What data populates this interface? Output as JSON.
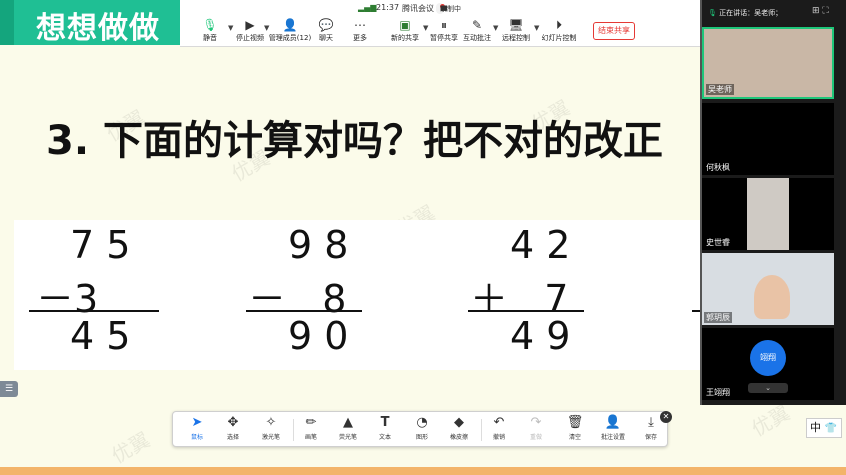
{
  "slide": {
    "title": "想想做做",
    "question": "3. 下面的计算对吗？把不对的改正",
    "watermark": "优翼",
    "problems": [
      {
        "top": "7 5",
        "mid": "－3",
        "result": "4 5"
      },
      {
        "top": "9 8",
        "mid": "－   8",
        "result": "9 0"
      },
      {
        "top": "4 2",
        "mid": "＋   7",
        "result": "4 9"
      }
    ]
  },
  "status_bar": {
    "time": "21:37",
    "app_name": "腾讯会议",
    "recording_label": "录制中",
    "signal_icon": "signal-bars-icon",
    "pause_icon": "pause-icon",
    "stop_icon": "stop-icon"
  },
  "meeting_toolbar": {
    "mute": {
      "label": "静音",
      "icon": "microphone-icon"
    },
    "stop_video": {
      "label": "停止视频",
      "icon": "video-camera-icon"
    },
    "participants": {
      "label": "管理成员(12)",
      "icon": "person-icon"
    },
    "chat": {
      "label": "聊天",
      "icon": "chat-icon"
    },
    "more": {
      "label": "更多",
      "icon": "ellipsis-icon"
    },
    "new_share": {
      "label": "新的共享",
      "icon": "screen-share-icon"
    },
    "pause_share": {
      "label": "暂停共享",
      "icon": "pause-icon"
    },
    "annotate": {
      "label": "互动批注",
      "icon": "annotate-icon"
    },
    "remote_control": {
      "label": "远程控制",
      "icon": "remote-control-icon"
    },
    "slideshow": {
      "label": "幻灯片控制",
      "icon": "slideshow-icon"
    },
    "end_share_label": "结束共享"
  },
  "participants_panel": {
    "speaking_label": "正在讲话：吴老师；",
    "members": [
      {
        "name": "吴老师"
      },
      {
        "name": "何秋枫"
      },
      {
        "name": "史世睿"
      },
      {
        "name": "郭玥辰"
      },
      {
        "name": "王翊翔"
      }
    ],
    "avatar_text": "翊翔",
    "collapse_icon": "chevron-down-icon"
  },
  "annotation_toolbar": {
    "tools": [
      {
        "label": "鼠标",
        "icon": "cursor-icon",
        "active": true
      },
      {
        "label": "选择",
        "icon": "move-icon"
      },
      {
        "label": "激光笔",
        "icon": "laser-pointer-icon"
      },
      {
        "label": "画笔",
        "icon": "pen-icon"
      },
      {
        "label": "荧光笔",
        "icon": "highlighter-icon"
      },
      {
        "label": "文本",
        "icon": "text-icon"
      },
      {
        "label": "图形",
        "icon": "shape-icon"
      },
      {
        "label": "橡皮擦",
        "icon": "eraser-icon"
      },
      {
        "label": "撤销",
        "icon": "undo-icon"
      },
      {
        "label": "重做",
        "icon": "redo-icon",
        "disabled": true
      },
      {
        "label": "清空",
        "icon": "trash-icon"
      },
      {
        "label": "批注设置",
        "icon": "annotation-settings-icon"
      },
      {
        "label": "保存",
        "icon": "download-icon"
      }
    ],
    "close_icon": "close-icon"
  },
  "ime": {
    "text": "中",
    "icon": "shirt-icon"
  },
  "colors": {
    "title_green": "#1fbf94",
    "accent_blue": "#1a73e8",
    "danger_red": "#e53935",
    "speaking_border": "#1ec67a",
    "bottom_stripe": "#f3b46a"
  }
}
